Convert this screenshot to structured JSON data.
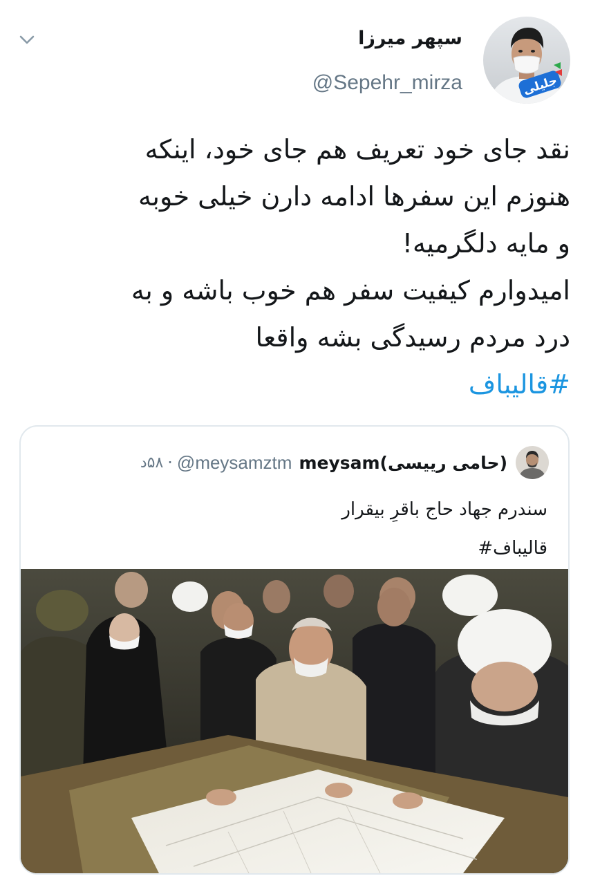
{
  "tweet": {
    "author": {
      "display_name": "سپهر میرزا",
      "handle": "@Sepehr_mirza",
      "avatar_badge": "جلیلی"
    },
    "text_lines": [
      "نقد جای خود تعریف هم جای خود، اینکه",
      "هنوزم این سفرها ادامه دارن خیلی خوبه",
      "و مایه دلگرمیه!",
      "امیدوارم کیفیت سفر هم خوب باشه و به",
      "درد مردم رسیدگی بشه واقعا"
    ],
    "hashtag": "#قالیباف",
    "menu_icon": "chevron-down-icon"
  },
  "quoted_tweet": {
    "display_name": "(حامی رییسی)meysam",
    "handle": "@meysamztm",
    "separator": "·",
    "time": "۵۸د",
    "text": "سندرم جهاد حاج باقرِ بیقرار",
    "hashtag": "قالیباف#"
  },
  "colors": {
    "link": "#1b95e0",
    "secondary_text": "#657786",
    "border": "#e1e8ed",
    "primary_text": "#14171a",
    "badge": "#1d6fd6"
  }
}
